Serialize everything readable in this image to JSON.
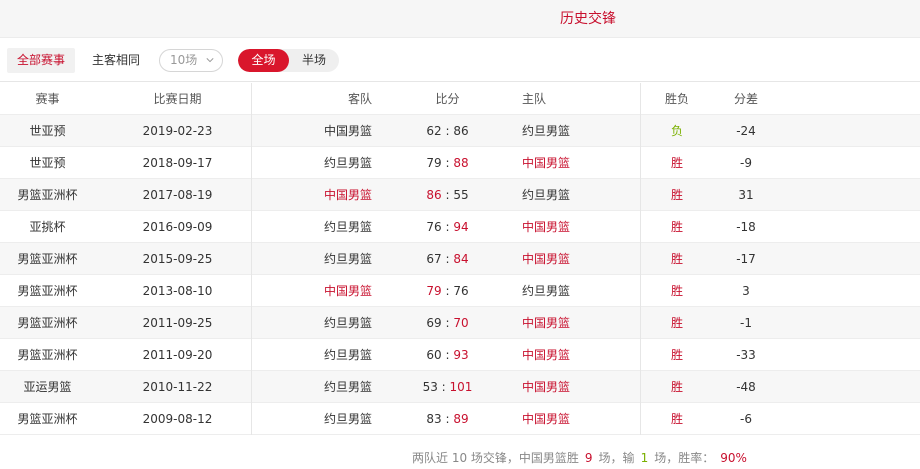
{
  "title": "历史交锋",
  "filters": {
    "all_label": "全部赛事",
    "same_label": "主客相同",
    "count_select": "10场",
    "full_label": "全场",
    "half_label": "半场"
  },
  "headers": {
    "event": "赛事",
    "date": "比赛日期",
    "away": "客队",
    "score": "比分",
    "home": "主队",
    "wl": "胜负",
    "diff": "分差"
  },
  "rows": [
    {
      "event": "世亚预",
      "date": "2019-02-23",
      "away": "中国男篮",
      "away_score": "62",
      "home_score": "86",
      "home": "约旦男篮",
      "wl": "负",
      "diff": "-24",
      "winner": "none",
      "wl_color": "green"
    },
    {
      "event": "世亚预",
      "date": "2018-09-17",
      "away": "约旦男篮",
      "away_score": "79",
      "home_score": "88",
      "home": "中国男篮",
      "wl": "胜",
      "diff": "-9",
      "winner": "home",
      "wl_color": "red"
    },
    {
      "event": "男篮亚洲杯",
      "date": "2017-08-19",
      "away": "中国男篮",
      "away_score": "86",
      "home_score": "55",
      "home": "约旦男篮",
      "wl": "胜",
      "diff": "31",
      "winner": "away",
      "wl_color": "red"
    },
    {
      "event": "亚挑杯",
      "date": "2016-09-09",
      "away": "约旦男篮",
      "away_score": "76",
      "home_score": "94",
      "home": "中国男篮",
      "wl": "胜",
      "diff": "-18",
      "winner": "home",
      "wl_color": "red"
    },
    {
      "event": "男篮亚洲杯",
      "date": "2015-09-25",
      "away": "约旦男篮",
      "away_score": "67",
      "home_score": "84",
      "home": "中国男篮",
      "wl": "胜",
      "diff": "-17",
      "winner": "home",
      "wl_color": "red"
    },
    {
      "event": "男篮亚洲杯",
      "date": "2013-08-10",
      "away": "中国男篮",
      "away_score": "79",
      "home_score": "76",
      "home": "约旦男篮",
      "wl": "胜",
      "diff": "3",
      "winner": "away",
      "wl_color": "red"
    },
    {
      "event": "男篮亚洲杯",
      "date": "2011-09-25",
      "away": "约旦男篮",
      "away_score": "69",
      "home_score": "70",
      "home": "中国男篮",
      "wl": "胜",
      "diff": "-1",
      "winner": "home",
      "wl_color": "red"
    },
    {
      "event": "男篮亚洲杯",
      "date": "2011-09-20",
      "away": "约旦男篮",
      "away_score": "60",
      "home_score": "93",
      "home": "中国男篮",
      "wl": "胜",
      "diff": "-33",
      "winner": "home",
      "wl_color": "red"
    },
    {
      "event": "亚运男篮",
      "date": "2010-11-22",
      "away": "约旦男篮",
      "away_score": "53",
      "home_score": "101",
      "home": "中国男篮",
      "wl": "胜",
      "diff": "-48",
      "winner": "home",
      "wl_color": "red"
    },
    {
      "event": "男篮亚洲杯",
      "date": "2009-08-12",
      "away": "约旦男篮",
      "away_score": "83",
      "home_score": "89",
      "home": "中国男篮",
      "wl": "胜",
      "diff": "-6",
      "winner": "home",
      "wl_color": "red"
    }
  ],
  "summary": {
    "prefix": "两队近 10 场交锋，中国男篮胜",
    "wins": "9",
    "mid": "场，输",
    "losses": "1",
    "suffix": "场，胜率：",
    "rate": "90%"
  },
  "colors": {
    "accent": "#c8102e",
    "loss": "#7ab000"
  }
}
